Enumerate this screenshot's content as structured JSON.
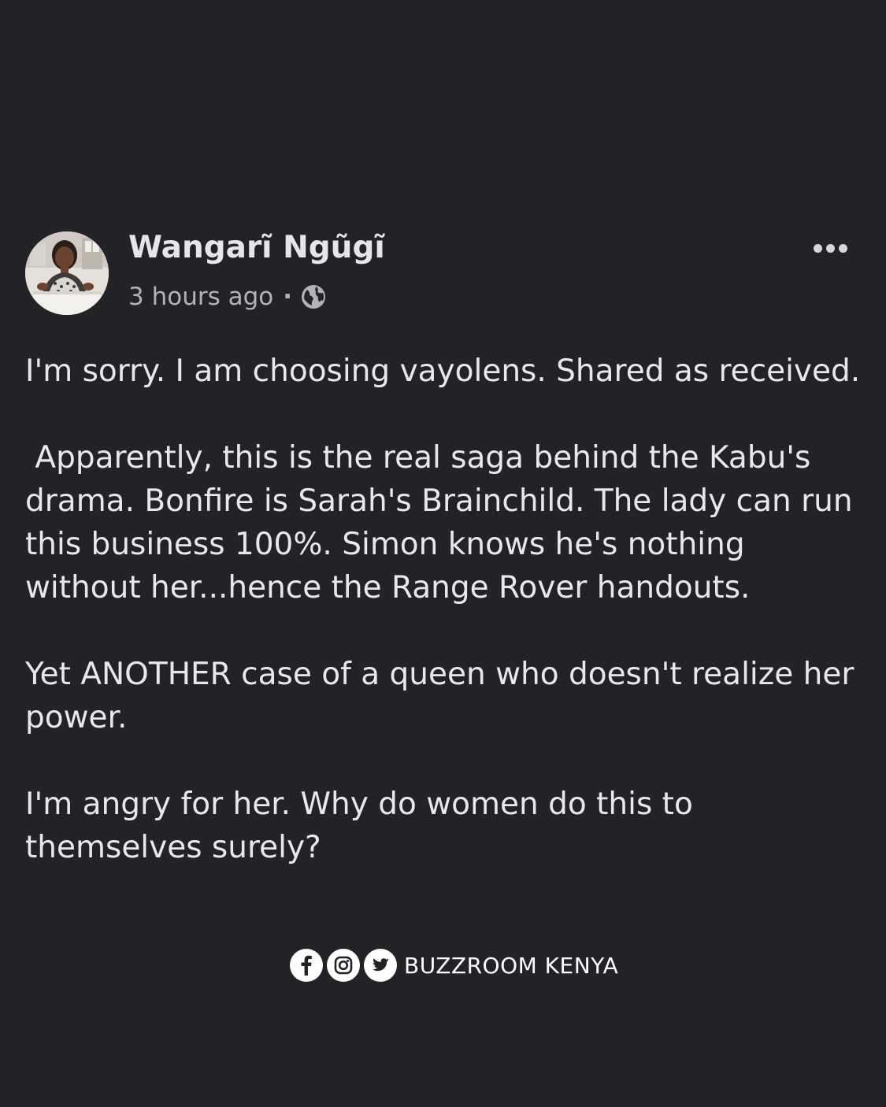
{
  "post": {
    "author": "Wangarĩ Ngũgĩ",
    "timestamp": "3 hours ago",
    "separator": "·",
    "privacy_icon": "globe-icon",
    "more_icon": "more-options-icon",
    "paragraphs": [
      "I'm sorry. I am choosing vayolens. Shared as received.",
      " Apparently, this is the real saga behind the Kabu's drama. Bonfire is Sarah's Brainchild. The lady can run this business 100%. Simon knows he's nothing without her...hence the Range Rover handouts.",
      "Yet ANOTHER case of a queen who doesn't realize her power.",
      "I'm angry for her. Why do women do this to themselves surely?"
    ]
  },
  "footer": {
    "brand": "BUZZROOM KENYA",
    "icons": [
      "facebook-icon",
      "instagram-icon",
      "twitter-icon"
    ]
  },
  "colors": {
    "background": "#232226",
    "text": "#e8e8ea",
    "secondary_text": "#b0b3b8"
  }
}
